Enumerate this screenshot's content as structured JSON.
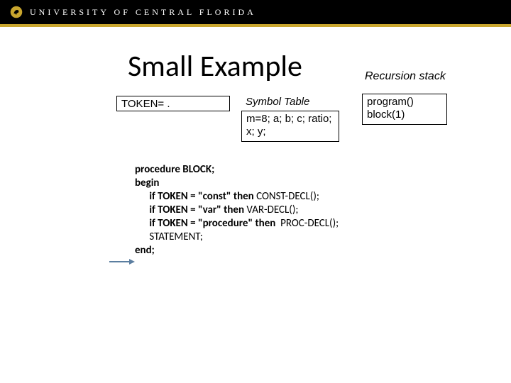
{
  "header": {
    "university_name": "UNIVERSITY OF CENTRAL FLORIDA",
    "logo_name": "pegasus-logo"
  },
  "title": "Small Example",
  "token_box": "TOKEN= .",
  "symbol_table": {
    "label": "Symbol Table",
    "contents": "m=8; a; b; c; ratio; x; y;"
  },
  "recursion_stack": {
    "label": "Recursion stack",
    "line1": "program()",
    "line2": "block(1)"
  },
  "code": {
    "l1": "procedure BLOCK;",
    "l2": "begin",
    "l3_a": "      if TOKEN = \"const\" ",
    "l3_b": "then",
    "l3_c": " CONST-DECL();",
    "l4_a": "      if TOKEN = \"var\" ",
    "l4_b": "then",
    "l4_c": " VAR-DECL();",
    "l5_a": "      if TOKEN = \"procedure\" ",
    "l5_b": "then",
    "l5_c": "  PROC-DECL();",
    "l6": "      STATEMENT;",
    "l7": "end;"
  }
}
